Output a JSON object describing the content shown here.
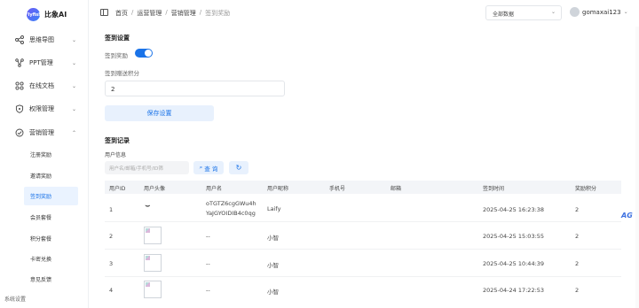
{
  "app": {
    "logo_text": "比象AI",
    "logo_mark": "Flyfish"
  },
  "sidebar": {
    "items": [
      {
        "label": "思维导图",
        "icon": "mindmap-icon"
      },
      {
        "label": "PPT管理",
        "icon": "ppt-icon"
      },
      {
        "label": "在线文档",
        "icon": "document-icon"
      },
      {
        "label": "权限管理",
        "icon": "shield-icon"
      },
      {
        "label": "营销管理",
        "icon": "marketing-icon"
      }
    ],
    "sub_items": [
      "注册奖励",
      "邀请奖励",
      "签到奖励",
      "会员套餐",
      "积分套餐",
      "卡密兑换",
      "意见反馈"
    ],
    "active_sub": "签到奖励",
    "footer": "系统设置"
  },
  "header": {
    "breadcrumb": [
      "首页",
      "运营管理",
      "营销管理",
      "签到奖励"
    ],
    "select_value": "全部数据",
    "username": "gomaxai123"
  },
  "settings": {
    "title": "签到设置",
    "toggle_label": "签到奖励",
    "toggle_on": true,
    "points_label": "签到赠送积分",
    "points_value": "2",
    "save_label": "保存设置"
  },
  "records": {
    "title": "签到记录",
    "filter_label": "用户信息",
    "search_placeholder": "用户名/邮箱/手机号/ID筛",
    "query_label": "查 询",
    "columns": [
      "用户ID",
      "用户头像",
      "用户名",
      "用户昵称",
      "手机号",
      "邮箱",
      "签到时间",
      "奖励积分"
    ],
    "rows": [
      {
        "id": "1",
        "avatar": "smile",
        "username_line1": "oTGTZ6cgGWu4h",
        "username_line2": "YaJGYOIDIB4c0qg",
        "nickname": "Laify",
        "phone": "",
        "email": "",
        "time": "2025-04-25 16:23:38",
        "points": "2"
      },
      {
        "id": "2",
        "avatar": "image",
        "username_line1": "--",
        "username_line2": "",
        "nickname": "小智",
        "phone": "",
        "email": "",
        "time": "2025-04-25 15:03:55",
        "points": "2"
      },
      {
        "id": "3",
        "avatar": "image",
        "username_line1": "--",
        "username_line2": "",
        "nickname": "小智",
        "phone": "",
        "email": "",
        "time": "2025-04-25 10:44:39",
        "points": "2"
      },
      {
        "id": "4",
        "avatar": "image",
        "username_line1": "--",
        "username_line2": "",
        "nickname": "小智",
        "phone": "",
        "email": "",
        "time": "2025-04-24 17:22:53",
        "points": "2"
      }
    ]
  },
  "floating": {
    "badge_text": "AG"
  }
}
